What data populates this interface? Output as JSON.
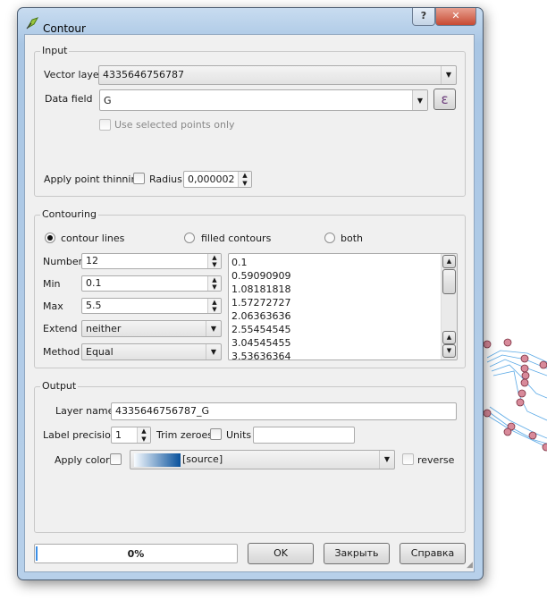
{
  "window": {
    "title": "Contour",
    "help_label": "?",
    "close_label": "✕"
  },
  "input": {
    "group_title": "Input",
    "vector_layer_label": "Vector layer",
    "vector_layer_value": "4335646756787",
    "data_field_label": "Data field",
    "data_field_value": "G",
    "expression_button": "ε",
    "use_selected_label": "Use selected points only",
    "use_selected_checked": false,
    "thinning_label": "Apply point thinning",
    "thinning_checked": false,
    "radius_label": "Radius",
    "radius_value": "0,000002"
  },
  "contouring": {
    "group_title": "Contouring",
    "modes": [
      {
        "label": "contour lines",
        "selected": true
      },
      {
        "label": "filled contours",
        "selected": false
      },
      {
        "label": "both",
        "selected": false
      }
    ],
    "number_label": "Number",
    "number_value": "12",
    "min_label": "Min",
    "min_value": "0.1",
    "max_label": "Max",
    "max_value": "5.5",
    "extend_label": "Extend",
    "extend_value": "neither",
    "method_label": "Method",
    "method_value": "Equal",
    "levels": [
      "0.1",
      "0.59090909",
      "1.08181818",
      "1.57272727",
      "2.06363636",
      "2.55454545",
      "3.04545455",
      "3.53636364"
    ]
  },
  "output": {
    "group_title": "Output",
    "layer_name_label": "Layer name",
    "layer_name_value": "4335646756787_G",
    "precision_label": "Label precision",
    "precision_value": "1",
    "trim_label": "Trim zeroes",
    "trim_checked": false,
    "units_label": "Units",
    "units_value": "",
    "apply_colors_label": "Apply colors",
    "apply_colors_checked": false,
    "ramp_value": "[source]",
    "reverse_label": "reverse",
    "reverse_checked": false,
    "ramp_colors": [
      "#f7fbff",
      "#08519c"
    ]
  },
  "footer": {
    "progress_text": "0%",
    "progress": 0,
    "ok_label": "OK",
    "close_label": "Закрыть",
    "help_label": "Справка"
  }
}
